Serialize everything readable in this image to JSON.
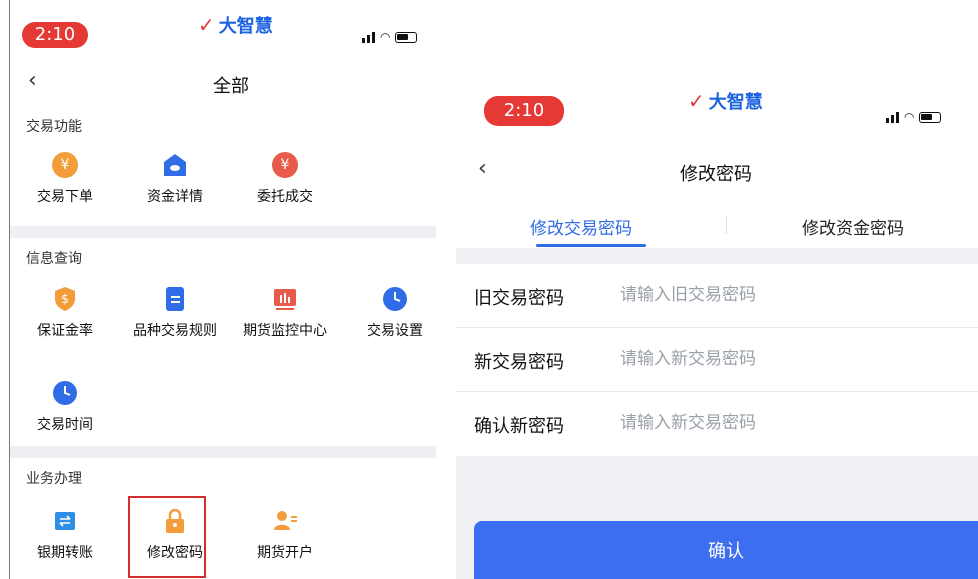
{
  "left": {
    "status": {
      "time": "2:10",
      "brand": "大智慧"
    },
    "nav": {
      "title": "全部"
    },
    "sections": [
      {
        "title": "交易功能",
        "items": [
          "交易下单",
          "资金详情",
          "委托成交"
        ]
      },
      {
        "title": "信息查询",
        "items": [
          "保证金率",
          "品种交易规则",
          "期货监控中心",
          "交易设置",
          "交易时间"
        ]
      },
      {
        "title": "业务办理",
        "items": [
          "银期转账",
          "修改密码",
          "期货开户"
        ]
      }
    ]
  },
  "right": {
    "status": {
      "time": "2:10",
      "brand": "大智慧"
    },
    "nav": {
      "title": "修改密码"
    },
    "tabs": [
      "修改交易密码",
      "修改资金密码"
    ],
    "fields": [
      {
        "label": "旧交易密码",
        "placeholder": "请输入旧交易密码",
        "value": ""
      },
      {
        "label": "新交易密码",
        "placeholder": "请输入新交易密码",
        "value": ""
      },
      {
        "label": "确认新密码",
        "placeholder": "请输入新交易密码",
        "value": ""
      }
    ],
    "confirm": "确认"
  },
  "colors": {
    "accent": "#2f6ce6",
    "button": "#3d6ef0",
    "status_pill": "#e53935",
    "highlight": "#d32f2f"
  }
}
